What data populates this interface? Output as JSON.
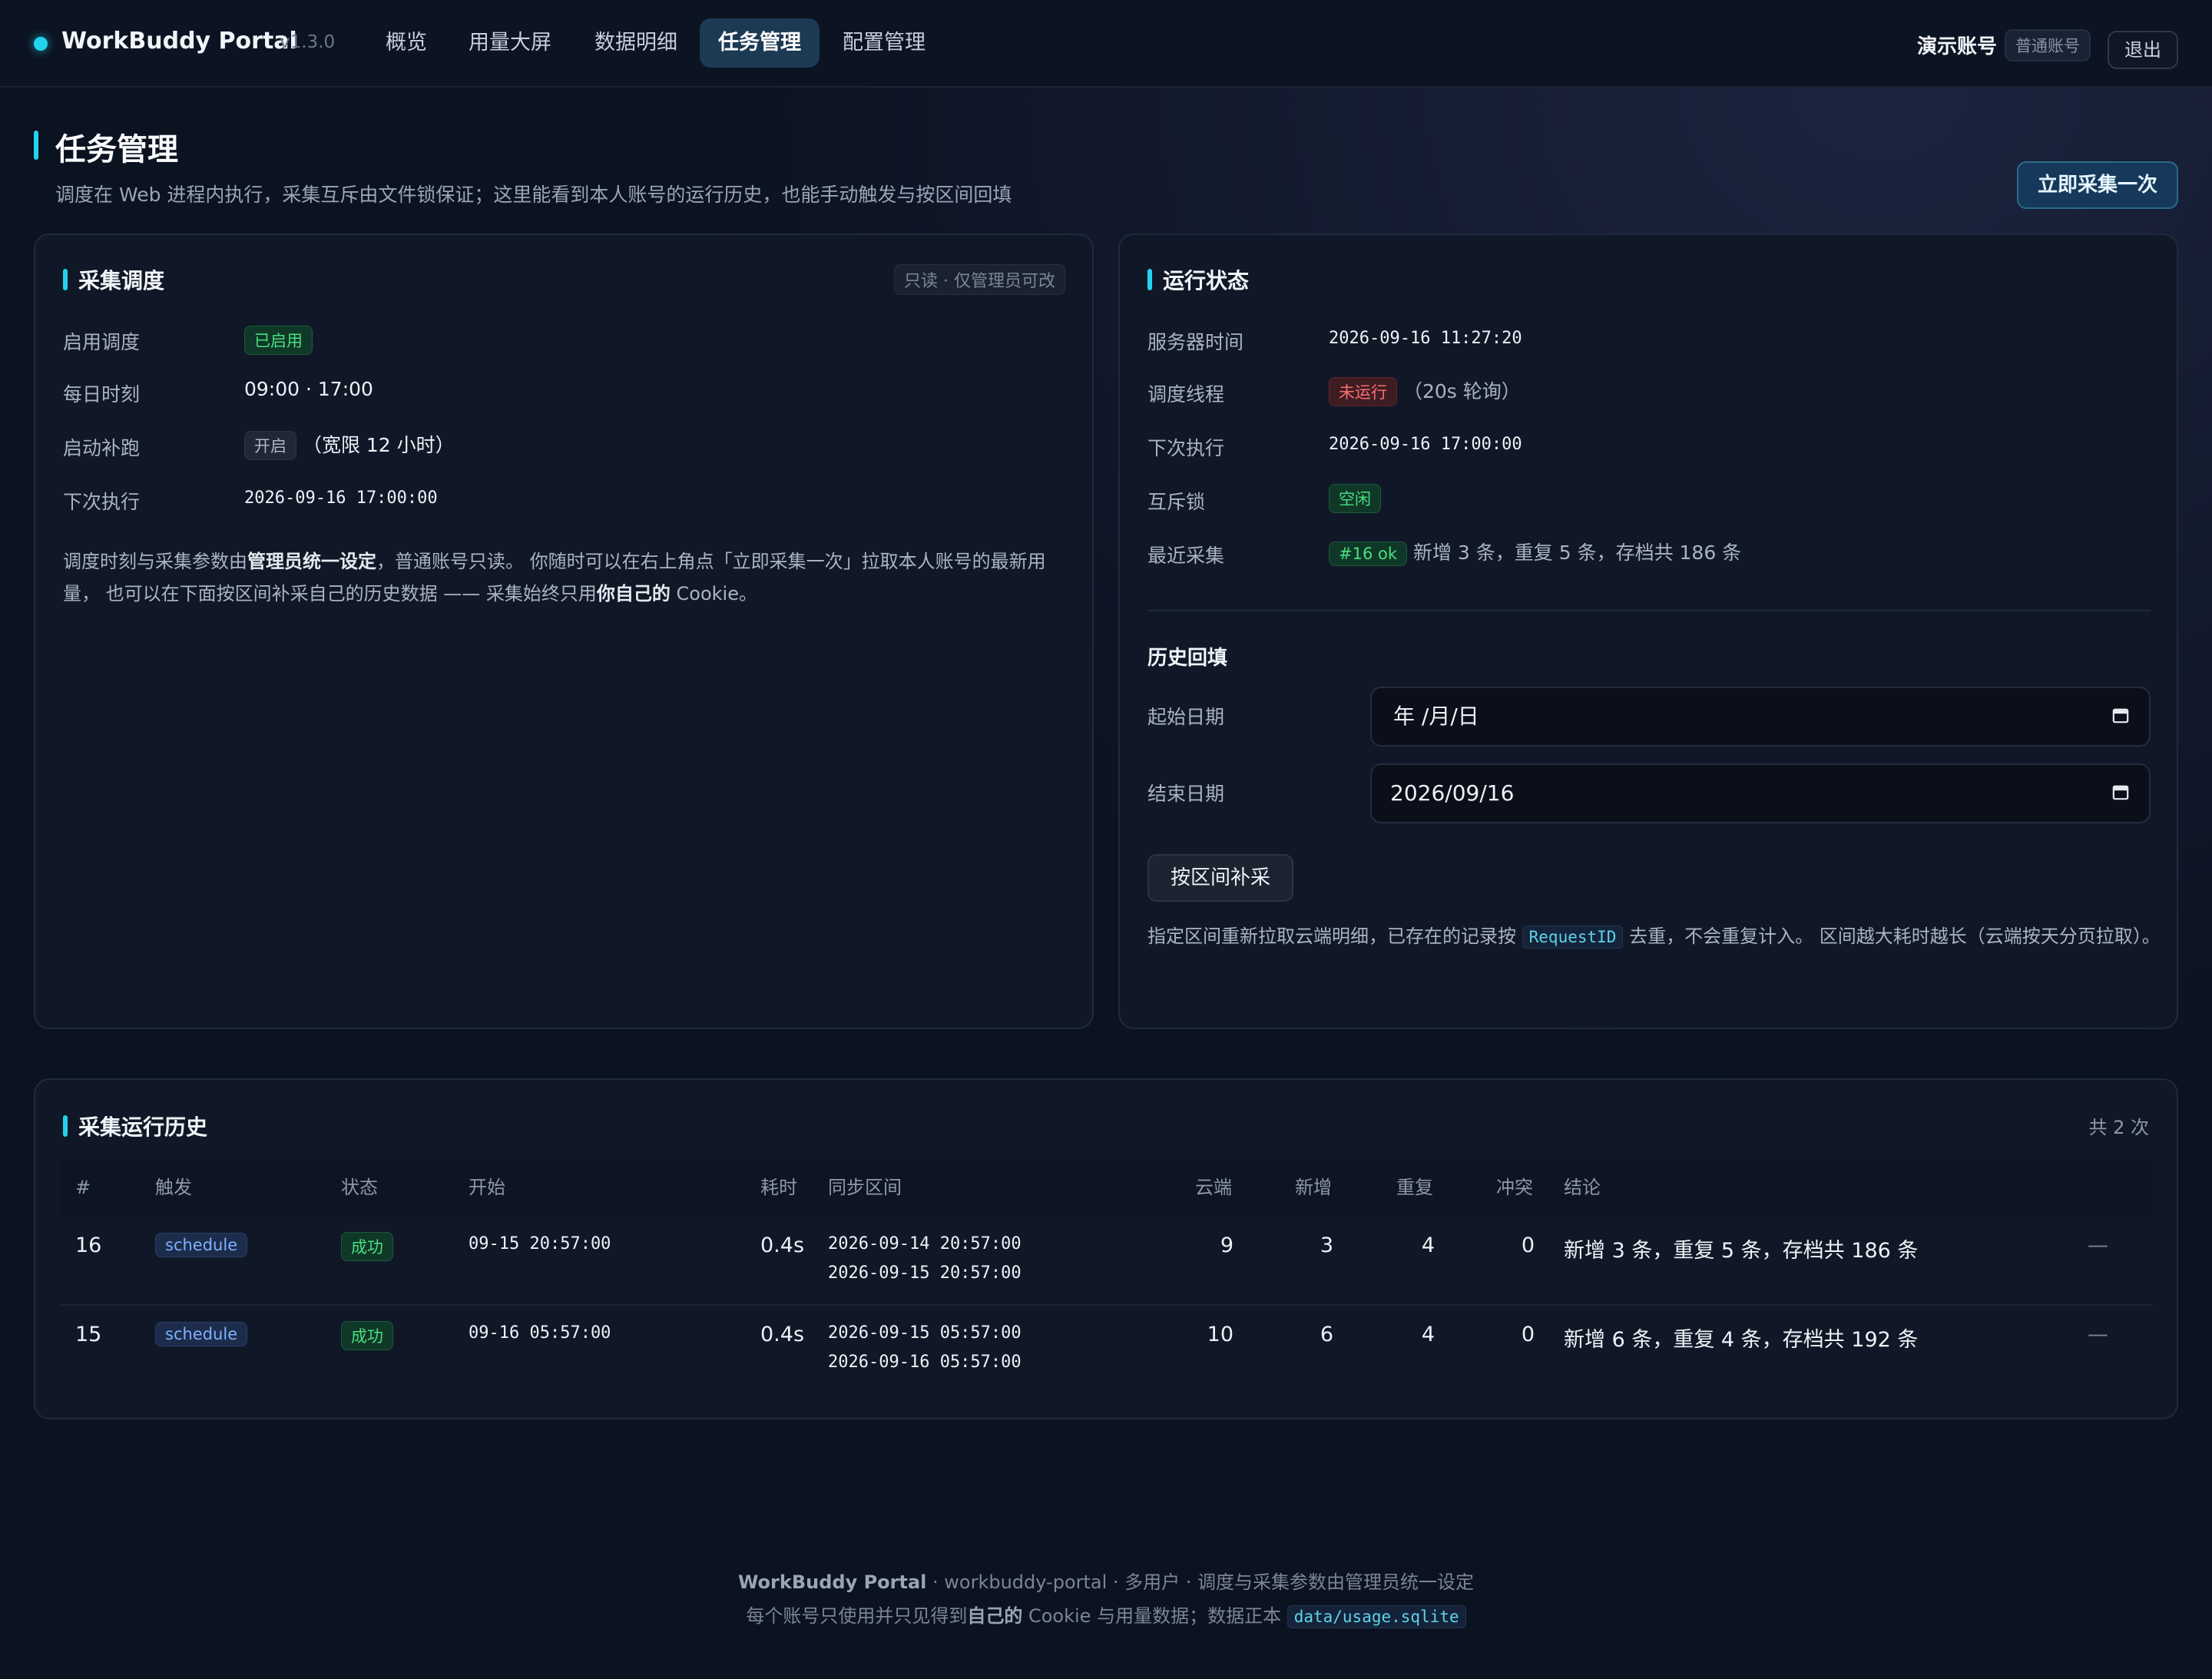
{
  "app": {
    "name": "WorkBuddy Portal",
    "version": "v1.3.0"
  },
  "nav": {
    "tabs": [
      {
        "label": "概览"
      },
      {
        "label": "用量大屏"
      },
      {
        "label": "数据明细"
      },
      {
        "label": "任务管理",
        "active": true
      },
      {
        "label": "配置管理"
      }
    ],
    "user_name": "演示账号",
    "user_role": "普通账号",
    "logout": "退出"
  },
  "header": {
    "title": "任务管理",
    "subtitle": "调度在 Web 进程内执行，采集互斥由文件锁保证；这里能看到本人账号的运行历史，也能手动触发与按区间回填",
    "collect_now": "立即采集一次"
  },
  "schedule_card": {
    "title": "采集调度",
    "readonly_tag": "只读 · 仅管理员可改",
    "rows": {
      "enable_label": "启用调度",
      "enable_value": "已启用",
      "daily_label": "每日时刻",
      "daily_value": "09:00 · 17:00",
      "catchup_label": "启动补跑",
      "catchup_pill": "开启",
      "catchup_extra": "（宽限 12 小时）",
      "next_label": "下次执行",
      "next_value": "2026-09-16 17:00:00"
    },
    "desc": {
      "p1": "调度时刻与采集参数由",
      "b1": "管理员统一设定",
      "p2": "，普通账号只读。 你随时可以在右上角点「立即采集一次」拉取本人账号的最新用量， 也可以在下面按区间补采自己的历史数据 —— 采集始终只用",
      "b2": "你自己的",
      "p3": " Cookie。"
    }
  },
  "status_card": {
    "title": "运行状态",
    "rows": {
      "server_time_label": "服务器时间",
      "server_time_value": "2026-09-16 11:27:20",
      "thread_label": "调度线程",
      "thread_pill": "未运行",
      "thread_extra": "（20s 轮询）",
      "next_label": "下次执行",
      "next_value": "2026-09-16 17:00:00",
      "lock_label": "互斥锁",
      "lock_value": "空闲",
      "last_label": "最近采集",
      "last_pill": "#16 ok",
      "last_text": "新增 3 条，重复 5 条，存档共 186 条"
    },
    "backfill": {
      "title": "历史回填",
      "start_label": "起始日期",
      "start_value": "年 /月/日",
      "end_label": "结束日期",
      "end_value": "2026/09/16",
      "button": "按区间补采",
      "desc_p1": "指定区间重新拉取云端明细，已存在的记录按 ",
      "desc_code": "RequestID",
      "desc_p2": " 去重，不会重复计入。 区间越大耗时越长（云端按天分页拉取）。"
    }
  },
  "history": {
    "title": "采集运行历史",
    "count": "共 2 次",
    "columns": [
      "#",
      "触发",
      "状态",
      "开始",
      "耗时",
      "同步区间",
      "云端",
      "新增",
      "重复",
      "冲突",
      "结论"
    ],
    "rows": [
      {
        "id": "16",
        "trigger": "schedule",
        "status": "成功",
        "start": "09-15 20:57:00",
        "duration": "0.4s",
        "range_from": "2026-09-14 20:57:00",
        "range_to": "2026-09-15 20:57:00",
        "cloud": "9",
        "new": "3",
        "dup": "4",
        "conflict": "0",
        "result": "新增 3 条，重复 5 条，存档共 186 条",
        "extra": "—"
      },
      {
        "id": "15",
        "trigger": "schedule",
        "status": "成功",
        "start": "09-16 05:57:00",
        "duration": "0.4s",
        "range_from": "2026-09-15 05:57:00",
        "range_to": "2026-09-16 05:57:00",
        "cloud": "10",
        "new": "6",
        "dup": "4",
        "conflict": "0",
        "result": "新增 6 条，重复 4 条，存档共 192 条",
        "extra": "—"
      }
    ]
  },
  "footer": {
    "brand": "WorkBuddy Portal",
    "line1_rest": " · workbuddy-portal · 多用户 · 调度与采集参数由管理员统一设定",
    "line2_p1": "每个账号只使用并只见得到",
    "line2_b": "自己的",
    "line2_p2": " Cookie 与用量数据；数据正本 ",
    "line2_code": "data/usage.sqlite"
  },
  "colors": {
    "accent": "#22d3ee",
    "background": "#0b1220",
    "card": "#101827",
    "success": "#4ade80",
    "danger": "#f87171"
  },
  "icons": {
    "brand": "status-dot-icon",
    "date_picker": "calendar-icon"
  }
}
